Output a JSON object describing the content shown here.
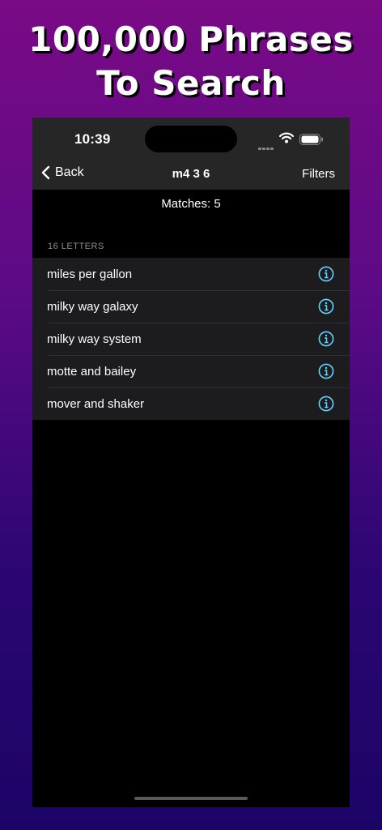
{
  "promo": {
    "line1": "100,000 Phrases",
    "line2": "To Search"
  },
  "status_bar": {
    "time": "10:39",
    "icons": [
      "cellular-signal-icon",
      "wifi-icon",
      "battery-icon"
    ]
  },
  "nav": {
    "back_label": "Back",
    "title": "m4 3 6",
    "filters_label": "Filters"
  },
  "results": {
    "matches_text": "Matches: 5",
    "section_header": "16 LETTERS",
    "items": [
      {
        "label": "miles per gallon"
      },
      {
        "label": "milky way galaxy"
      },
      {
        "label": "milky way system"
      },
      {
        "label": "motte and bailey"
      },
      {
        "label": "mover and shaker"
      }
    ]
  },
  "colors": {
    "accent": "#64d2ff",
    "background_top": "#7a0a86",
    "background_bottom": "#1c0466",
    "bar": "#262626",
    "row": "#1c1c1e"
  }
}
